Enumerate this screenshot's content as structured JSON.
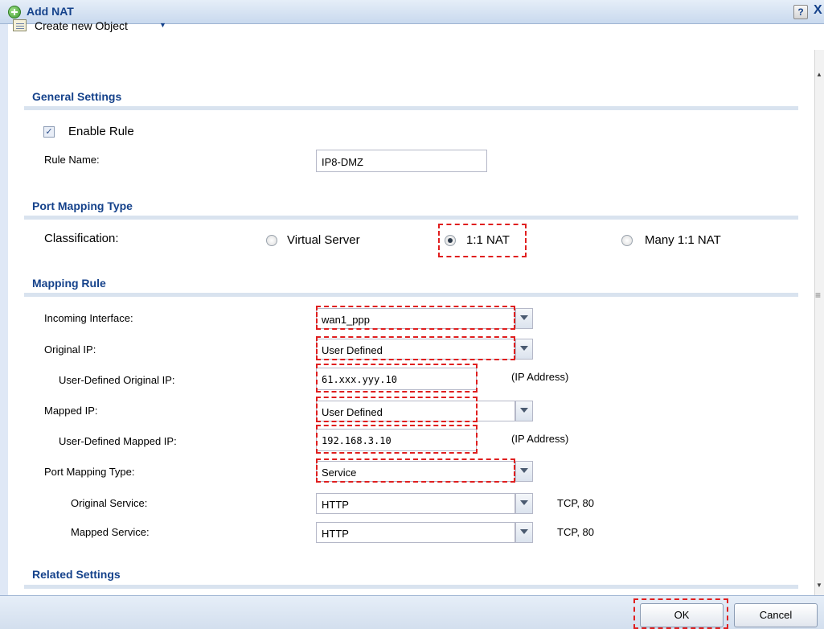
{
  "dialog": {
    "title": "Add NAT",
    "help": "?",
    "close": "X"
  },
  "toolbar": {
    "create_label": "Create new Object",
    "create_arrow": "▼"
  },
  "general": {
    "title": "General Settings",
    "enable_label": "Enable Rule",
    "enable_checked": true,
    "rule_name_label": "Rule Name:",
    "rule_name_value": "IP8-DMZ"
  },
  "port_mapping": {
    "title": "Port Mapping Type",
    "classification_label": "Classification:",
    "options": [
      "Virtual Server",
      "1:1 NAT",
      "Many 1:1 NAT"
    ],
    "selected": "1:1 NAT"
  },
  "mapping_rule": {
    "title": "Mapping Rule",
    "incoming_interface_label": "Incoming Interface:",
    "incoming_interface_value": "wan1_ppp",
    "original_ip_label": "Original IP:",
    "original_ip_value": "User Defined",
    "user_defined_original_ip_label": "User-Defined Original IP:",
    "user_defined_original_ip_value": "61.xxx.yyy.10",
    "original_ip_hint": "(IP Address)",
    "mapped_ip_label": "Mapped IP:",
    "mapped_ip_value": "User Defined",
    "user_defined_mapped_ip_label": "User-Defined Mapped IP:",
    "user_defined_mapped_ip_value": "192.168.3.10",
    "mapped_ip_hint": "(IP Address)",
    "port_mapping_type_label": "Port Mapping Type:",
    "port_mapping_type_value": "Service",
    "original_service_label": "Original Service:",
    "original_service_value": "HTTP",
    "original_service_info": "TCP, 80",
    "mapped_service_label": "Mapped Service:",
    "mapped_service_value": "HTTP",
    "mapped_service_info": "TCP, 80"
  },
  "related": {
    "title": "Related Settings"
  },
  "footer": {
    "ok_label": "OK",
    "cancel_label": "Cancel"
  },
  "colors": {
    "section_title": "#15428b",
    "highlight": "#e01f1f",
    "title_bar": "#c9d9ee"
  }
}
